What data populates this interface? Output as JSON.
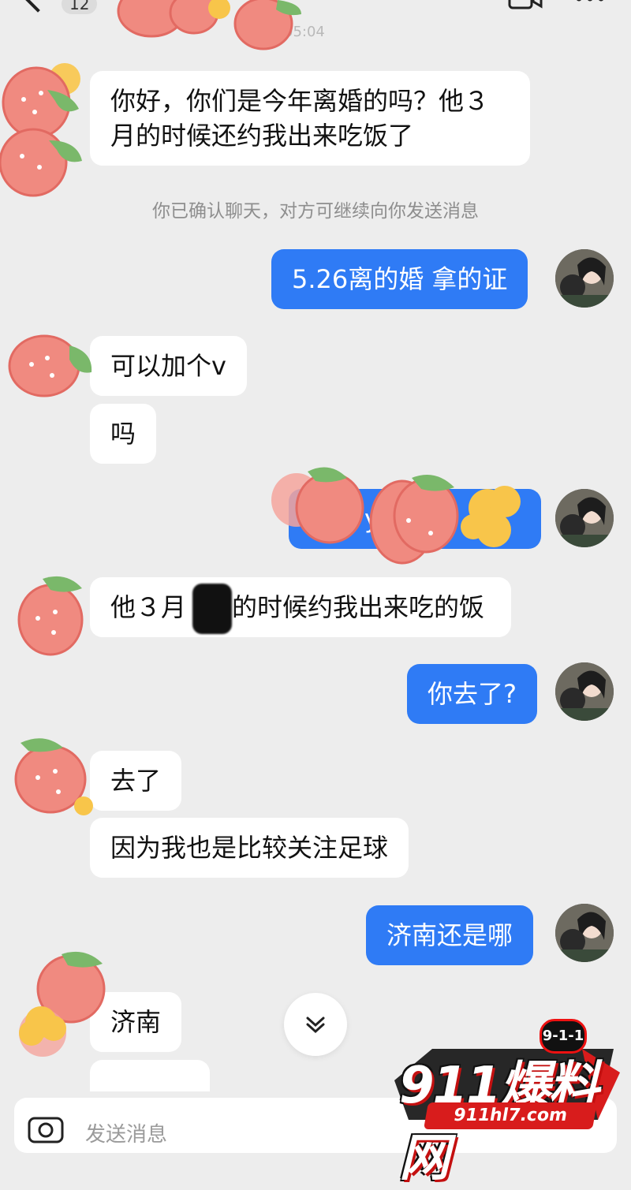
{
  "header": {
    "unread_count": "12",
    "timestamp": "05:04"
  },
  "messages": [
    {
      "id": "m1",
      "from": "them",
      "text": "你好，你们是今年离婚的吗？他３月的时候还约我出来吃饭了"
    },
    {
      "id": "sys",
      "type": "system",
      "text": "你已确认聊天，对方可继续向你发送消息"
    },
    {
      "id": "m2",
      "from": "me",
      "text": "5.26离的婚 拿的证"
    },
    {
      "id": "m3",
      "from": "them",
      "text": "可以加个v"
    },
    {
      "id": "m4",
      "from": "them",
      "text": "吗"
    },
    {
      "id": "m5",
      "from": "me",
      "text": "y"
    },
    {
      "id": "m6",
      "from": "them",
      "text_before": "他３月",
      "text_after": "的时候约我出来吃的饭"
    },
    {
      "id": "m7",
      "from": "me",
      "text": "你去了?"
    },
    {
      "id": "m8",
      "from": "them",
      "text": "去了"
    },
    {
      "id": "m9",
      "from": "them",
      "text": "因为我也是比较关注足球"
    },
    {
      "id": "m10",
      "from": "me",
      "text": "济南还是哪"
    },
    {
      "id": "m11",
      "from": "them",
      "text": "济南"
    }
  ],
  "input": {
    "placeholder": "发送消息"
  },
  "watermark": {
    "brand": "911爆料网",
    "url": "911hl7.com",
    "badge": "9-1-1"
  },
  "colors": {
    "background": "#ededed",
    "my_bubble": "#2f7bf5",
    "their_bubble": "#ffffff",
    "system_text": "#8e8e8e"
  },
  "icons": [
    "back-chevron-icon",
    "video-call-icon",
    "more-icon",
    "scroll-down-icon",
    "camera-icon",
    "strawberry-sticker",
    "flower-sticker"
  ]
}
